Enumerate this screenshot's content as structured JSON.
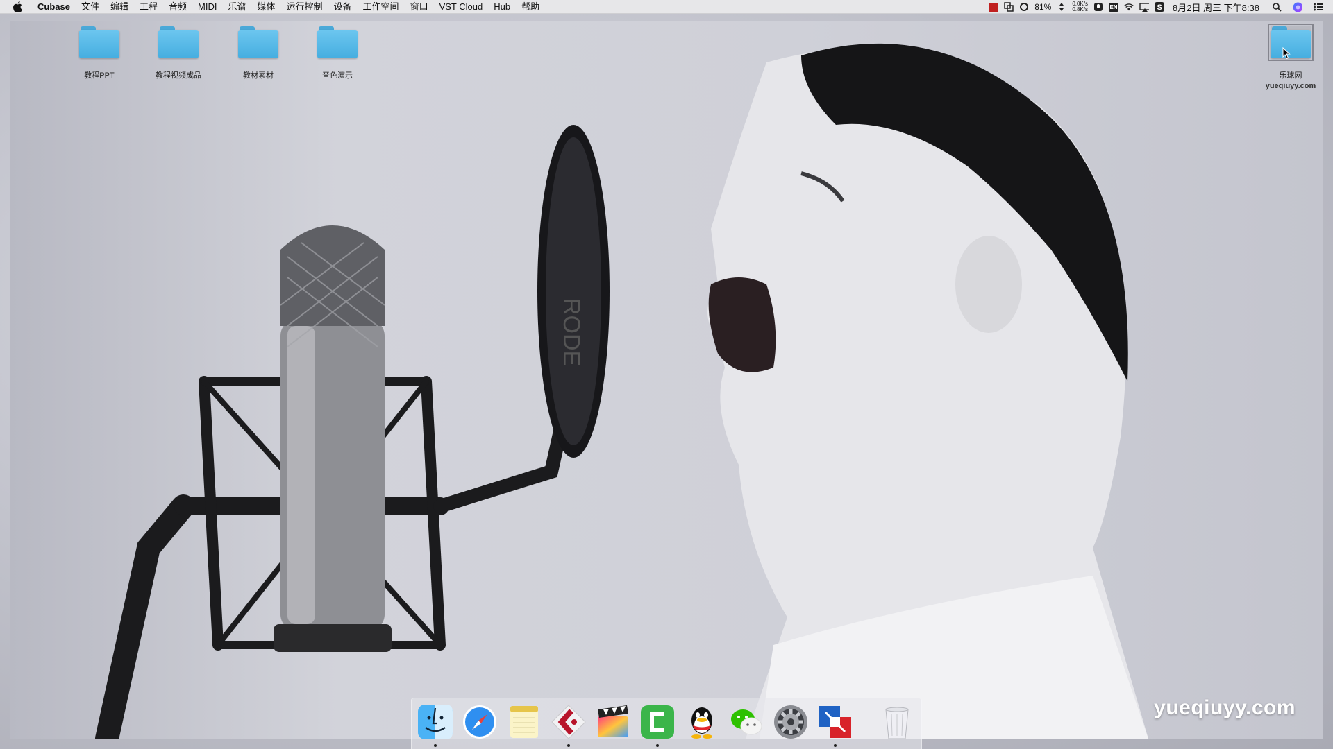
{
  "menubar": {
    "app_name": "Cubase",
    "menus": [
      "文件",
      "编辑",
      "工程",
      "音频",
      "MIDI",
      "乐谱",
      "媒体",
      "运行控制",
      "设备",
      "工作空间",
      "窗口",
      "VST Cloud",
      "Hub",
      "帮助"
    ],
    "battery": "81%",
    "net_up": "0.0K/s",
    "net_down": "0.8K/s",
    "input_method": "EN",
    "clock": "8月2日 周三 下午8:38"
  },
  "desktop": {
    "icons": [
      {
        "label": "教程PPT"
      },
      {
        "label": "教程视频成品"
      },
      {
        "label": "教材素材"
      },
      {
        "label": "音色演示"
      }
    ],
    "right_icon": {
      "label": "乐球网",
      "sub_label": "yueqiuyy.com"
    }
  },
  "watermark": "yueqiuyy.com",
  "dock": {
    "apps": [
      {
        "name": "finder-icon",
        "running": true
      },
      {
        "name": "safari-icon",
        "running": false
      },
      {
        "name": "notes-icon",
        "running": false
      },
      {
        "name": "cubase-icon",
        "running": true
      },
      {
        "name": "final-cut-icon",
        "running": false
      },
      {
        "name": "camtasia-icon",
        "running": true
      },
      {
        "name": "qq-icon",
        "running": false
      },
      {
        "name": "wechat-icon",
        "running": false
      },
      {
        "name": "system-preferences-icon",
        "running": false
      },
      {
        "name": "parallels-icon",
        "running": true
      }
    ],
    "trash": "trash-icon"
  },
  "colors": {
    "folder": "#4aa9d8",
    "menubar": "#e7e7e9",
    "watermark": "#ffffff"
  }
}
